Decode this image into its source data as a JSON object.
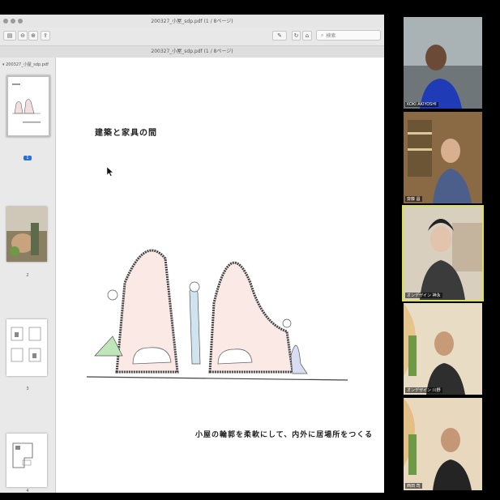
{
  "window": {
    "title": "200327_小屋_sdp.pdf (1 / 8ページ)"
  },
  "toolbar": {
    "search_placeholder": "検索"
  },
  "docbar": {
    "title": "200327_小屋_sdp.pdf (1 / 8ページ)"
  },
  "sidebar": {
    "header": "200327_小屋_sdp.pdf",
    "pages": [
      {
        "num": "1",
        "selected": true
      },
      {
        "num": "2",
        "selected": false
      },
      {
        "num": "3",
        "selected": false
      },
      {
        "num": "4",
        "selected": false
      }
    ]
  },
  "page": {
    "heading": "建築と家具の間",
    "caption": "小屋の輪郭を柔軟にして、内外に居場所をつくる"
  },
  "participants": [
    {
      "name": "KOKI AKIYOSHI"
    },
    {
      "name": "齋藤 昌"
    },
    {
      "name": "オンデザイン 神永"
    },
    {
      "name": "オンデザイン 川野"
    },
    {
      "name": "西田 司"
    }
  ]
}
